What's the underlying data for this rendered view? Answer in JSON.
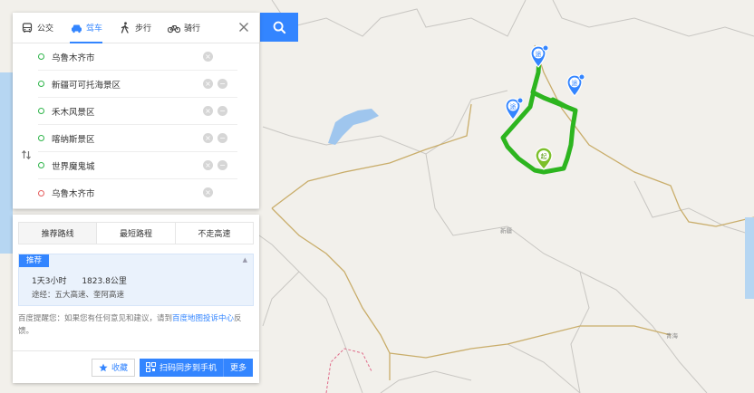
{
  "modes": [
    {
      "label": "公交",
      "icon": "bus-icon"
    },
    {
      "label": "驾车",
      "icon": "car-icon",
      "active": true
    },
    {
      "label": "步行",
      "icon": "walk-icon"
    },
    {
      "label": "骑行",
      "icon": "bike-icon"
    }
  ],
  "stops": [
    {
      "value": "乌鲁木齐市",
      "type": "start"
    },
    {
      "value": "新疆可可托海景区",
      "type": "via"
    },
    {
      "value": "禾木风景区",
      "type": "via"
    },
    {
      "value": "喀纳斯景区",
      "type": "via"
    },
    {
      "value": "世界魔鬼城",
      "type": "via"
    },
    {
      "value": "乌鲁木齐市",
      "type": "end"
    }
  ],
  "tabs": [
    "推荐路线",
    "最短路程",
    "不走高速"
  ],
  "route": {
    "badge": "推荐",
    "duration": "1天3小时",
    "distance": "1823.8公里",
    "via": "途经：五大高速、奎阿高速"
  },
  "tip": {
    "prefix": "百度提醒您：如果您有任何意见和建议，请到",
    "link": "百度地图投诉中心",
    "suffix": "反馈。"
  },
  "actions": {
    "favorite": "收藏",
    "sync": "扫码同步到手机",
    "more": "更多"
  },
  "map": {
    "label_xinjiang": "新疆",
    "label_qinghai": "青海",
    "marker_start": "起",
    "marker_via": "途",
    "route_color": "#2db51f",
    "accent": "#3385ff"
  }
}
